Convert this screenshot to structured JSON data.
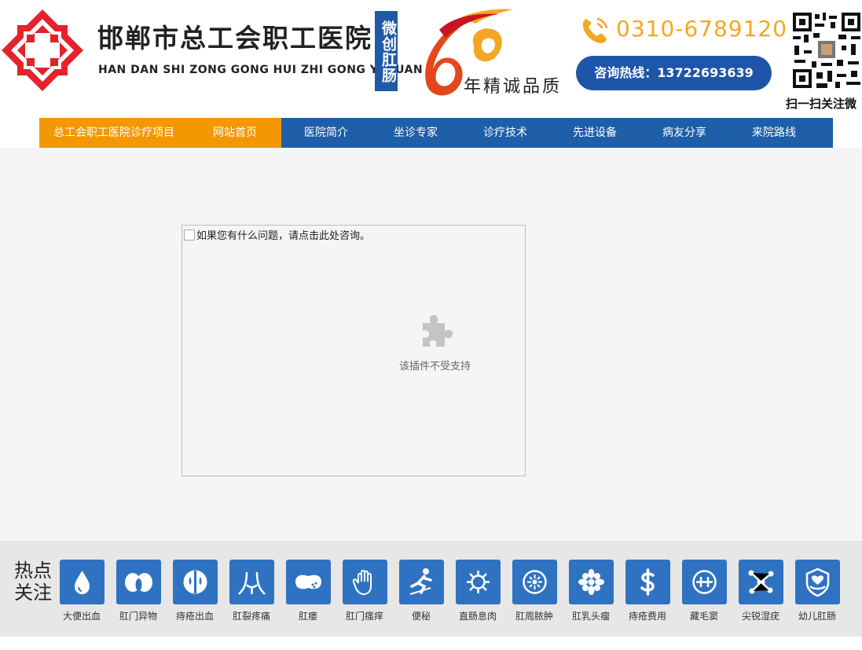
{
  "header": {
    "title_cn": "邯郸市总工会职工医院",
    "title_en": "HAN DAN SHI ZONG GONG HUI ZHI GONG YI YUAN",
    "badge": "微创肛肠",
    "anniversary_text": "年精诚品质",
    "phone": "0310-6789120",
    "hotline": "咨询热线：13722693639",
    "qr_caption": "扫一扫关注微",
    "colors": {
      "brand_blue": "#1f5ea8",
      "accent_orange": "#f39800",
      "logo_red": "#e4222b"
    }
  },
  "nav": {
    "items": [
      {
        "label": "总工会职工医院诊疗项目"
      },
      {
        "label": "网站首页"
      },
      {
        "label": "医院简介"
      },
      {
        "label": "坐诊专家"
      },
      {
        "label": "诊疗技术"
      },
      {
        "label": "先进设备"
      },
      {
        "label": "病友分享"
      },
      {
        "label": "来院路线"
      }
    ]
  },
  "main": {
    "plugin_alt": "如果您有什么问题，请点击此处咨询。",
    "plugin_message": "该插件不受支持",
    "plugin_icon": "puzzle-icon"
  },
  "hot": {
    "title_line1": "热点",
    "title_line2": "关注",
    "items": [
      {
        "label": "大便出血",
        "icon": "blood-drop-icon"
      },
      {
        "label": "肛门异物",
        "icon": "lungs-icon"
      },
      {
        "label": "痔疮出血",
        "icon": "hemorrhoid-bleed-icon"
      },
      {
        "label": "肛裂疼痛",
        "icon": "fissure-icon"
      },
      {
        "label": "肛瘘",
        "icon": "fistula-icon"
      },
      {
        "label": "肛门瘙痒",
        "icon": "hand-icon"
      },
      {
        "label": "便秘",
        "icon": "person-squat-icon"
      },
      {
        "label": "直肠息肉",
        "icon": "virus-icon"
      },
      {
        "label": "肛周脓肿",
        "icon": "cycle-icon"
      },
      {
        "label": "肛乳头瘤",
        "icon": "flower-icon"
      },
      {
        "label": "痔疮费用",
        "icon": "dollar-icon"
      },
      {
        "label": "藏毛窦",
        "icon": "medical-icon"
      },
      {
        "label": "尖锐湿疣",
        "icon": "molecule-icon"
      },
      {
        "label": "幼儿肛肠",
        "icon": "shield-hands-icon"
      }
    ]
  }
}
